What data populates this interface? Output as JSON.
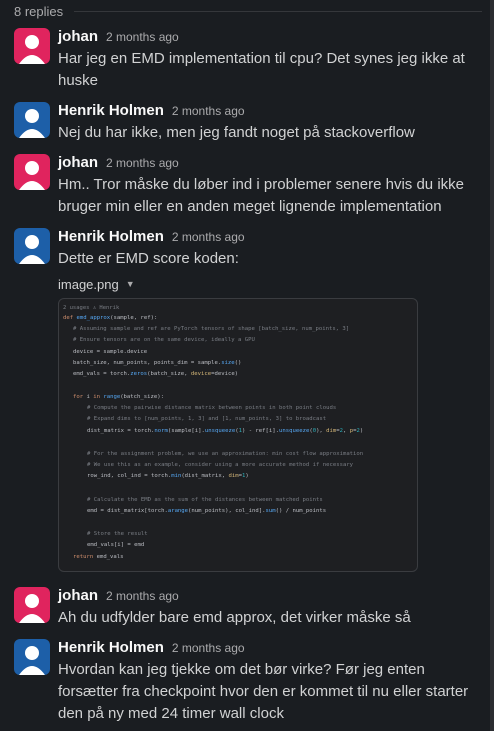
{
  "thread": {
    "replies_count": "8 replies",
    "colors": {
      "background": "#1a1d21",
      "johan_avatar": "#e0245e",
      "henrik_avatar": "#1d5fa8"
    },
    "messages": [
      {
        "author": "johan",
        "time": "2 months ago",
        "avatar": "user-avatar-icon",
        "text": "Har jeg en EMD implementation til cpu? Det synes jeg ikke at huske"
      },
      {
        "author": "Henrik Holmen",
        "time": "2 months ago",
        "avatar": "user-avatar-icon",
        "text": "Nej du har ikke, men jeg fandt noget på stackoverflow"
      },
      {
        "author": "johan",
        "time": "2 months ago",
        "avatar": "user-avatar-icon",
        "text": "Hm.. Tror måske du løber ind i problemer senere hvis du ikke bruger min eller en anden meget lignende implementation"
      },
      {
        "author": "Henrik Holmen",
        "time": "2 months ago",
        "avatar": "user-avatar-icon",
        "text": "Dette er EMD score koden:"
      },
      {
        "author": "johan",
        "time": "2 months ago",
        "avatar": "user-avatar-icon",
        "text": "Ah du udfylder bare emd approx, det virker måske så"
      },
      {
        "author": "Henrik Holmen",
        "time": "2 months ago",
        "avatar": "user-avatar-icon",
        "text": "Hvordan kan jeg tjekke om det bør virke? Før jeg enten forsætter fra checkpoint hvor den er kommet til nu eller starter den på ny med 24 timer wall clock"
      }
    ],
    "attachment": {
      "file_name": "image.png",
      "caret_icon": "chevron-down-icon",
      "code_hint": "2 usages  ♙ Henrik",
      "code": {
        "l1_kw": "def ",
        "l1_fn": "emd_approx",
        "l1_tx": "(sample, ref):",
        "l2": "# Assuming sample and ref are PyTorch tensors of shape [batch_size, num_points, 3]",
        "l3": "# Ensure tensors are on the same device, ideally a GPU",
        "l4": "device = sample.device",
        "l5a": "batch_size, num_points, points_dim = sample.",
        "l5b": "size",
        "l5c": "()",
        "l6a": "emd_vals = torch.",
        "l6b": "zeros",
        "l6c": "(batch_size, ",
        "l6d": "device",
        "l6e": "=device)",
        "l7a": "for ",
        "l7b": "i ",
        "l7c": "in ",
        "l7d": "range",
        "l7e": "(batch_size):",
        "l8": "# Compute the pairwise distance matrix between points in both point clouds",
        "l9": "# Expand dims to [num_points, 1, 3] and [1, num_points, 3] to broadcast",
        "l10a": "dist_matrix = torch.",
        "l10b": "norm",
        "l10c": "(sample[i].",
        "l10d": "unsqueeze",
        "l10e": "(",
        "l10f": "1",
        "l10g": ") - ref[i].",
        "l10h": "unsqueeze",
        "l10i": "(",
        "l10j": "0",
        "l10k": "), ",
        "l10l": "dim",
        "l10m": "=",
        "l10n": "2",
        "l10o": ", ",
        "l10p": "p",
        "l10q": "=",
        "l10r": "2",
        "l10s": ")",
        "l11": "# For the assignment problem, we use an approximation: min cost flow approximation",
        "l12": "# We use this as an example, consider using a more accurate method if necessary",
        "l13a": "row_ind, col_ind = torch.",
        "l13b": "min",
        "l13c": "(dist_matrix, ",
        "l13d": "dim",
        "l13e": "=",
        "l13f": "1",
        "l13g": ")",
        "l14": "# Calculate the EMD as the sum of the distances between matched points",
        "l15a": "emd = dist_matrix[torch.",
        "l15b": "arange",
        "l15c": "(num_points), col_ind].",
        "l15d": "sum",
        "l15e": "() / num_points",
        "l16": "# Store the result",
        "l17": "emd_vals[i] = emd",
        "l18a": "return ",
        "l18b": "emd_vals"
      }
    }
  }
}
